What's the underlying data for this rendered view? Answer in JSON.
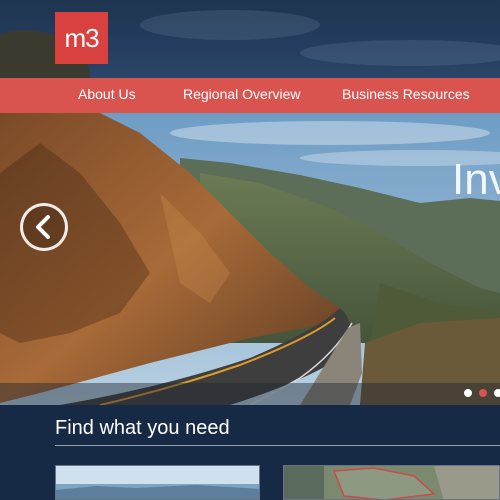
{
  "header": {
    "logo_text": "m3"
  },
  "nav": {
    "items": [
      {
        "label": "About Us"
      },
      {
        "label": "Regional Overview"
      },
      {
        "label": "Business Resources"
      }
    ]
  },
  "hero": {
    "title": "Inv",
    "active_slide": 2,
    "slide_count": 3
  },
  "section": {
    "title": "Find what you need"
  },
  "colors": {
    "brand_red": "#d94141",
    "nav_red": "#d9534f",
    "navy": "#172a45"
  }
}
